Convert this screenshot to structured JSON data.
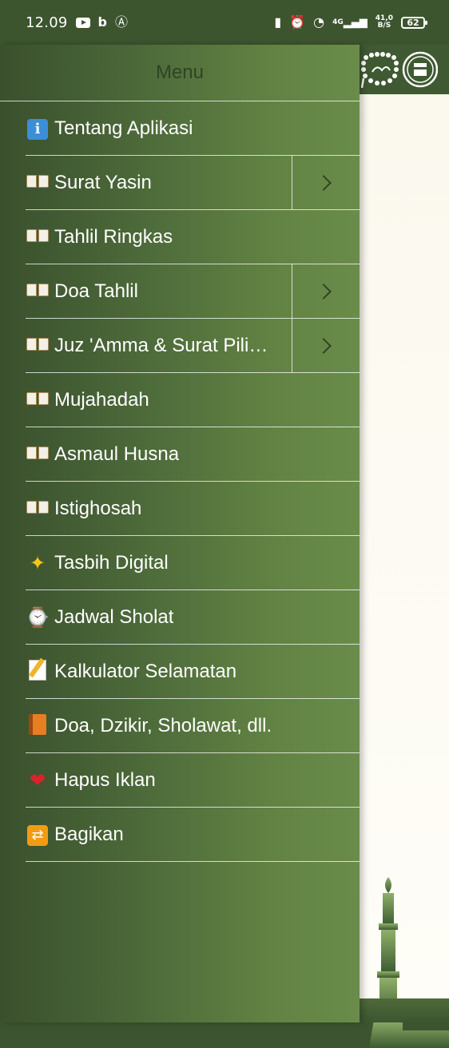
{
  "status_bar": {
    "time": "12.09",
    "net_type": "4G",
    "net_speed_value": "41,0",
    "net_speed_unit": "B/S",
    "battery": "62"
  },
  "drawer": {
    "title": "Menu",
    "items": [
      {
        "icon": "info-icon",
        "label": "Tentang Aplikasi",
        "expandable": false
      },
      {
        "icon": "open-book-icon",
        "label": "Surat Yasin",
        "expandable": true
      },
      {
        "icon": "open-book-icon",
        "label": "Tahlil Ringkas",
        "expandable": false
      },
      {
        "icon": "open-book-icon",
        "label": "Doa Tahlil",
        "expandable": true
      },
      {
        "icon": "open-book-icon",
        "label": "Juz 'Amma & Surat Pili…",
        "expandable": true
      },
      {
        "icon": "open-book-icon",
        "label": "Mujahadah",
        "expandable": false
      },
      {
        "icon": "open-book-icon",
        "label": "Asmaul Husna",
        "expandable": false
      },
      {
        "icon": "open-book-icon",
        "label": "Istighosah",
        "expandable": false
      },
      {
        "icon": "dizzy-star-icon",
        "label": "Tasbih Digital",
        "expandable": false
      },
      {
        "icon": "watch-icon",
        "label": "Jadwal Sholat",
        "expandable": false
      },
      {
        "icon": "memo-icon",
        "label": "Kalkulator Selamatan",
        "expandable": false
      },
      {
        "icon": "orange-book-icon",
        "label": "Doa, Dzikir, Sholawat, dll.",
        "expandable": false
      },
      {
        "icon": "heart-icon",
        "label": "Hapus Iklan",
        "expandable": false
      },
      {
        "icon": "shuffle-icon",
        "label": "Bagikan",
        "expandable": false
      }
    ]
  },
  "colors": {
    "drawer_dark": "#3a502d",
    "drawer_light": "#6a8c4a",
    "app_bar": "#3f5a32",
    "content_bg": "#fbf8ee"
  }
}
